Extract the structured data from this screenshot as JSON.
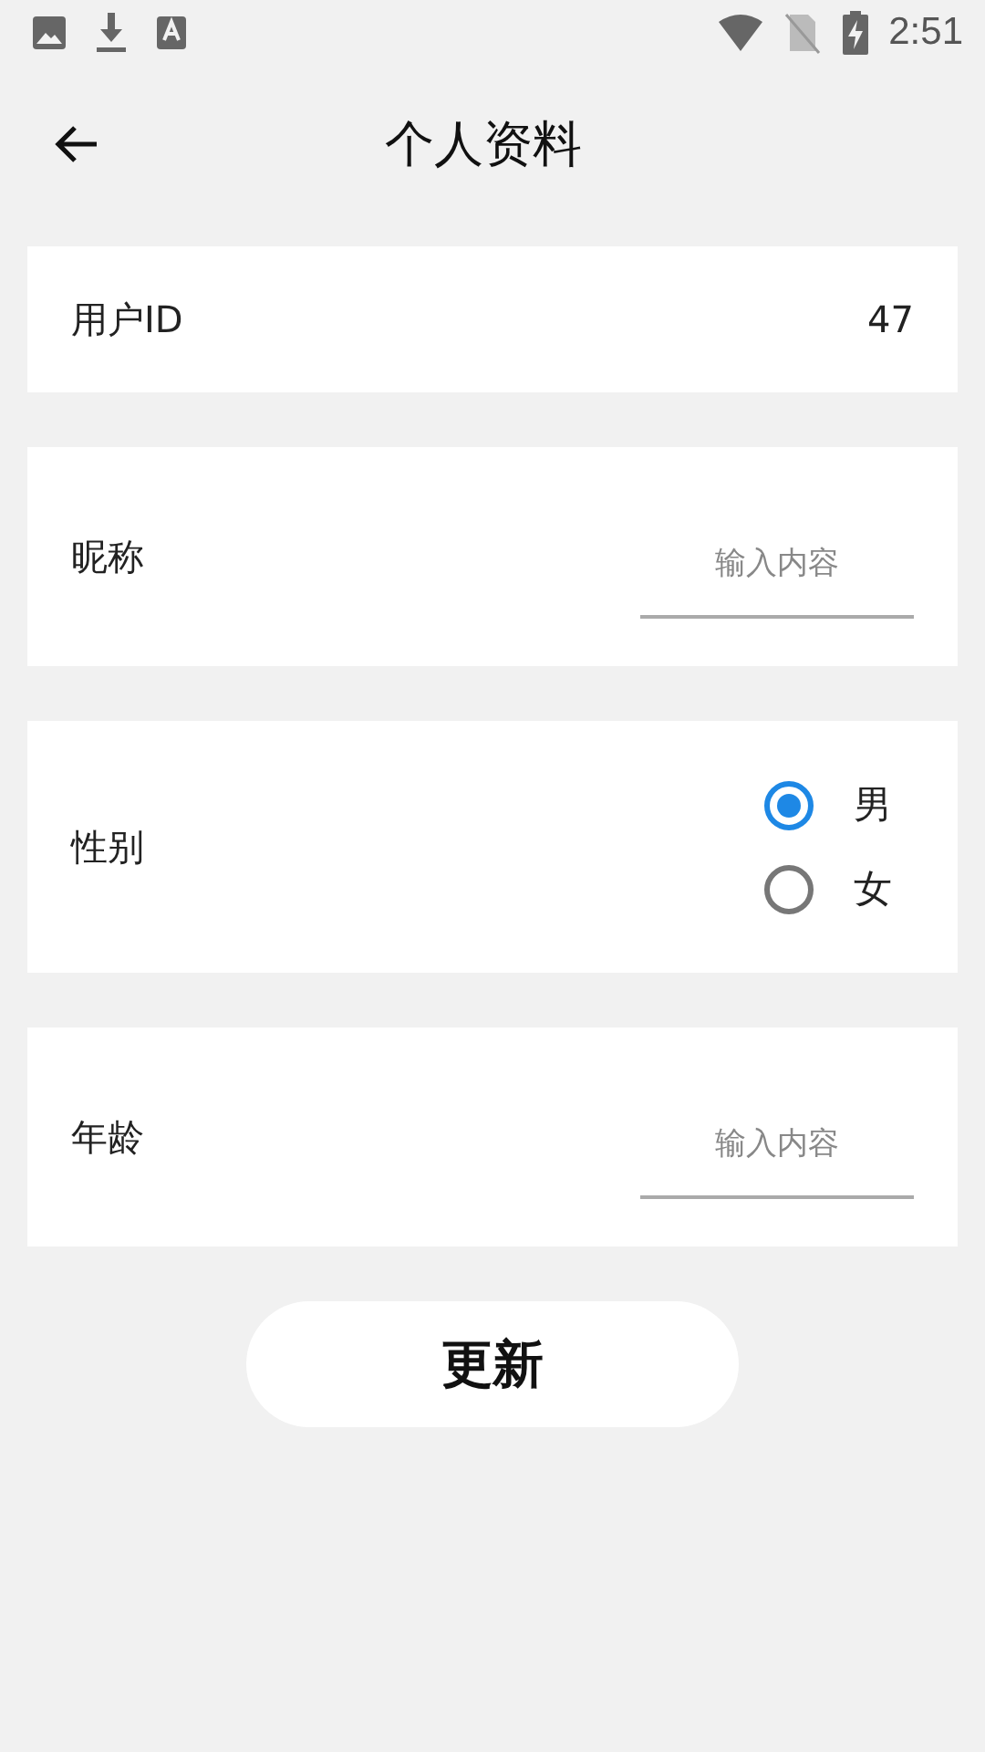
{
  "status_bar": {
    "time": "2:51"
  },
  "header": {
    "title": "个人资料"
  },
  "fields": [
    {
      "kind": "value",
      "label": "用户ID",
      "value": "47"
    },
    {
      "kind": "input",
      "label": "昵称",
      "placeholder": "输入内容"
    },
    {
      "kind": "radio",
      "label": "性别",
      "options": [
        {
          "label": "男",
          "selected": true
        },
        {
          "label": "女",
          "selected": false
        }
      ]
    },
    {
      "kind": "input",
      "label": "年龄",
      "placeholder": "输入内容"
    }
  ],
  "submit_button": "更新"
}
